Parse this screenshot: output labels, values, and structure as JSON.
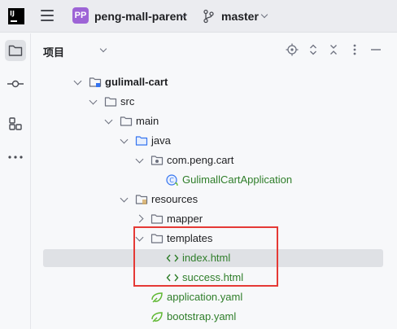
{
  "titlebar": {
    "logo_text": "IJ",
    "project_badge": "PP",
    "project_name": "peng-mall-parent",
    "branch_name": "master",
    "colors": {
      "project_badge": "#9d64d6"
    }
  },
  "leftbar": {
    "items": [
      {
        "icon": "folder-icon",
        "active": true
      },
      {
        "icon": "commit-icon",
        "active": false
      },
      {
        "icon": "structure-icon",
        "active": false
      },
      {
        "icon": "more-icon",
        "active": false
      }
    ]
  },
  "toolwindow": {
    "title": "项目",
    "tools": [
      "locate-icon",
      "expand-all-icon",
      "collapse-all-icon",
      "options-icon",
      "hide-icon"
    ]
  },
  "tree": {
    "rows": [
      {
        "label": "gulimall-cart",
        "icon": "module-folder-icon",
        "depth": 0,
        "expanded": true,
        "bold": true,
        "green": false,
        "selected": false
      },
      {
        "label": "src",
        "icon": "folder-icon",
        "depth": 1,
        "expanded": true,
        "bold": false,
        "green": false,
        "selected": false
      },
      {
        "label": "main",
        "icon": "folder-icon",
        "depth": 2,
        "expanded": true,
        "bold": false,
        "green": false,
        "selected": false
      },
      {
        "label": "java",
        "icon": "source-folder-icon",
        "depth": 3,
        "expanded": true,
        "bold": false,
        "green": false,
        "selected": false
      },
      {
        "label": "com.peng.cart",
        "icon": "package-icon",
        "depth": 4,
        "expanded": true,
        "bold": false,
        "green": false,
        "selected": false
      },
      {
        "label": "GulimallCartApplication",
        "icon": "spring-class-icon",
        "depth": 5,
        "expanded": null,
        "bold": false,
        "green": true,
        "selected": false
      },
      {
        "label": "resources",
        "icon": "resources-folder-icon",
        "depth": 3,
        "expanded": true,
        "bold": false,
        "green": false,
        "selected": false
      },
      {
        "label": "mapper",
        "icon": "folder-icon",
        "depth": 4,
        "expanded": false,
        "bold": false,
        "green": false,
        "selected": false
      },
      {
        "label": "templates",
        "icon": "folder-icon",
        "depth": 4,
        "expanded": true,
        "bold": false,
        "green": false,
        "selected": false
      },
      {
        "label": "index.html",
        "icon": "html-file-icon",
        "depth": 5,
        "expanded": null,
        "bold": false,
        "green": true,
        "selected": true
      },
      {
        "label": "success.html",
        "icon": "html-file-icon",
        "depth": 5,
        "expanded": null,
        "bold": false,
        "green": true,
        "selected": false
      },
      {
        "label": "application.yaml",
        "icon": "spring-yaml-icon",
        "depth": 4,
        "expanded": null,
        "bold": false,
        "green": true,
        "selected": false
      },
      {
        "label": "bootstrap.yaml",
        "icon": "spring-yaml-icon",
        "depth": 4,
        "expanded": null,
        "bold": false,
        "green": true,
        "selected": false
      }
    ]
  },
  "colors": {
    "selection": "#dfe1e5",
    "new_file_text": "#2f7e2a",
    "highlight_box": "#e53935",
    "folder_stroke": "#6c707e",
    "source_folder_stroke": "#3574f0"
  }
}
